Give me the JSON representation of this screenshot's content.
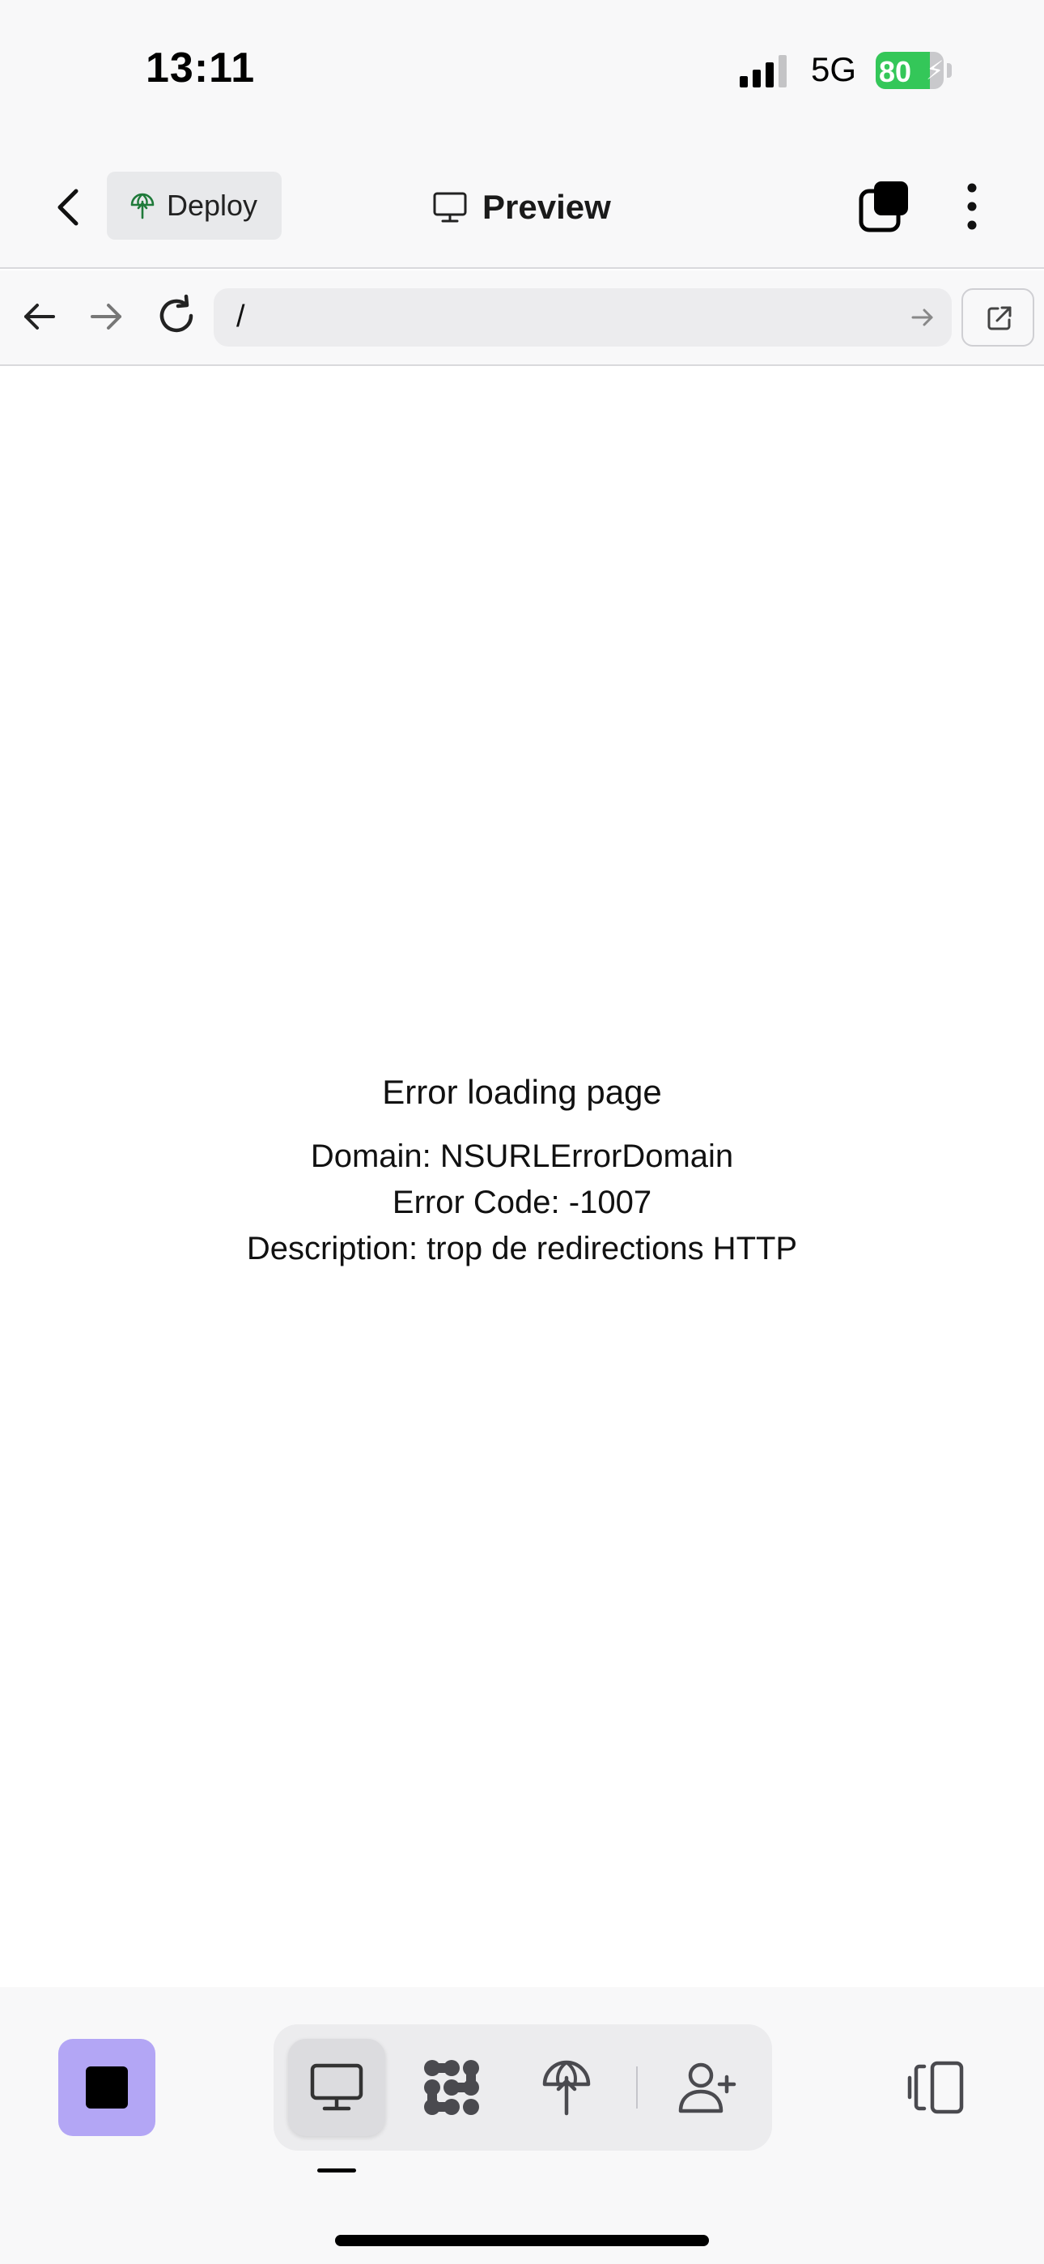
{
  "status_bar": {
    "time": "13:11",
    "network": "5G",
    "battery_percent": "80",
    "battery_level": 0.8,
    "battery_charging": true
  },
  "nav": {
    "deploy_label": "Deploy",
    "title": "Preview"
  },
  "url_bar": {
    "url": "/"
  },
  "error": {
    "title": "Error loading page",
    "domain_line": "Domain: NSURLErrorDomain",
    "code_line": "Error Code: -1007",
    "description_line": "Description: trop de redirections HTTP"
  },
  "toolbar": {
    "items": [
      "monitor-icon",
      "workspace-icon",
      "deploy-icon",
      "invite-user-icon"
    ],
    "active_item": "monitor-icon"
  },
  "colors": {
    "accent_purple": "#b3a6f5",
    "battery_green": "#34c759",
    "deploy_icon_green": "#1f7a3a",
    "background": "#f8f8f9"
  }
}
